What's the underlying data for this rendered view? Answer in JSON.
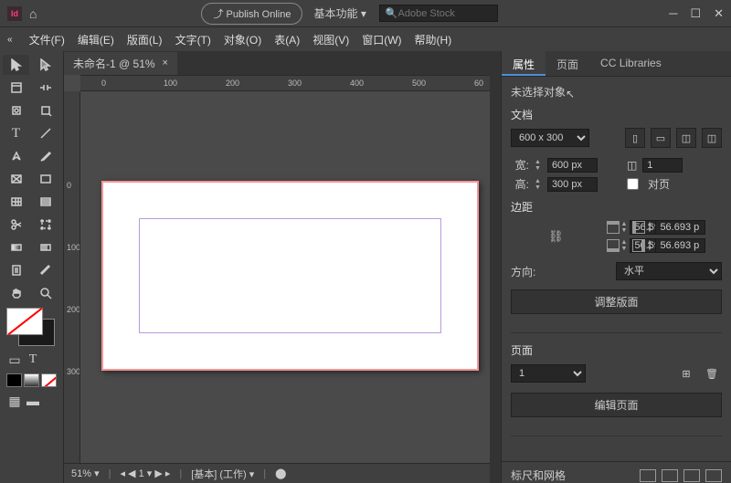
{
  "app": {
    "abbr": "Id",
    "publish": "Publish Online",
    "workspace": "基本功能",
    "search_ph": "Adobe Stock"
  },
  "menus": {
    "file": "文件(F)",
    "edit": "编辑(E)",
    "layout": "版面(L)",
    "type": "文字(T)",
    "object": "对象(O)",
    "table": "表(A)",
    "view": "视图(V)",
    "window": "窗口(W)",
    "help": "帮助(H)"
  },
  "doc_tab": {
    "title": "未命名-1 @ 51%",
    "close": "×"
  },
  "ruler_h": [
    "0",
    "100",
    "200",
    "300",
    "400",
    "500",
    "60"
  ],
  "ruler_v": [
    "0",
    "100",
    "200",
    "300"
  ],
  "status": {
    "zoom": "51%",
    "page": "1",
    "layer": "[基本] (工作)"
  },
  "panel": {
    "tabs": {
      "prop": "属性",
      "pages": "页面",
      "cc": "CC Libraries"
    },
    "no_sel": "未选择对象",
    "doc_h": "文档",
    "preset": "600 x 300",
    "w_lbl": "宽:",
    "w": "600 px",
    "h_lbl": "高:",
    "h": "300 px",
    "pages_lbl": "",
    "pages": "1",
    "facing": "对页",
    "margin_h": "边距",
    "m_t": "56.693 p",
    "m_b": "56.693 p",
    "m_l": "56.693 p",
    "m_r": "56.693 p",
    "orient_lbl": "方向:",
    "orient": "水平",
    "adjust": "调整版面",
    "page_h": "页面",
    "page_sel": "1",
    "edit_page": "编辑页面",
    "ruler_h2": "标尺和网格"
  }
}
